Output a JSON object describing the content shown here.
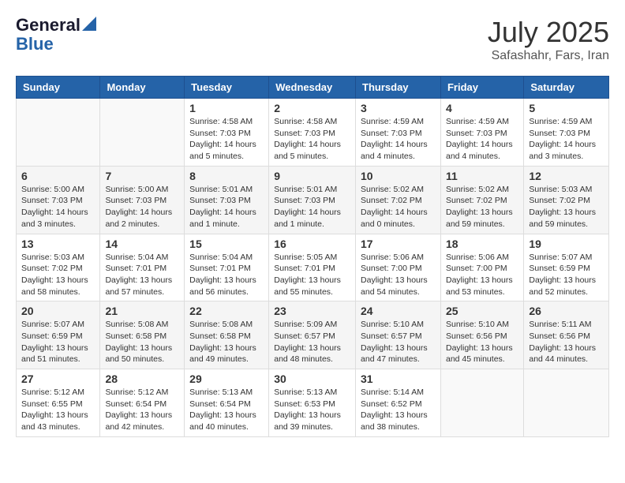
{
  "logo": {
    "general": "General",
    "blue": "Blue"
  },
  "title": {
    "month_year": "July 2025",
    "location": "Safashahr, Fars, Iran"
  },
  "weekdays": [
    "Sunday",
    "Monday",
    "Tuesday",
    "Wednesday",
    "Thursday",
    "Friday",
    "Saturday"
  ],
  "weeks": [
    [
      {
        "day": "",
        "info": ""
      },
      {
        "day": "",
        "info": ""
      },
      {
        "day": "1",
        "info": "Sunrise: 4:58 AM\nSunset: 7:03 PM\nDaylight: 14 hours\nand 5 minutes."
      },
      {
        "day": "2",
        "info": "Sunrise: 4:58 AM\nSunset: 7:03 PM\nDaylight: 14 hours\nand 5 minutes."
      },
      {
        "day": "3",
        "info": "Sunrise: 4:59 AM\nSunset: 7:03 PM\nDaylight: 14 hours\nand 4 minutes."
      },
      {
        "day": "4",
        "info": "Sunrise: 4:59 AM\nSunset: 7:03 PM\nDaylight: 14 hours\nand 4 minutes."
      },
      {
        "day": "5",
        "info": "Sunrise: 4:59 AM\nSunset: 7:03 PM\nDaylight: 14 hours\nand 3 minutes."
      }
    ],
    [
      {
        "day": "6",
        "info": "Sunrise: 5:00 AM\nSunset: 7:03 PM\nDaylight: 14 hours\nand 3 minutes."
      },
      {
        "day": "7",
        "info": "Sunrise: 5:00 AM\nSunset: 7:03 PM\nDaylight: 14 hours\nand 2 minutes."
      },
      {
        "day": "8",
        "info": "Sunrise: 5:01 AM\nSunset: 7:03 PM\nDaylight: 14 hours\nand 1 minute."
      },
      {
        "day": "9",
        "info": "Sunrise: 5:01 AM\nSunset: 7:03 PM\nDaylight: 14 hours\nand 1 minute."
      },
      {
        "day": "10",
        "info": "Sunrise: 5:02 AM\nSunset: 7:02 PM\nDaylight: 14 hours\nand 0 minutes."
      },
      {
        "day": "11",
        "info": "Sunrise: 5:02 AM\nSunset: 7:02 PM\nDaylight: 13 hours\nand 59 minutes."
      },
      {
        "day": "12",
        "info": "Sunrise: 5:03 AM\nSunset: 7:02 PM\nDaylight: 13 hours\nand 59 minutes."
      }
    ],
    [
      {
        "day": "13",
        "info": "Sunrise: 5:03 AM\nSunset: 7:02 PM\nDaylight: 13 hours\nand 58 minutes."
      },
      {
        "day": "14",
        "info": "Sunrise: 5:04 AM\nSunset: 7:01 PM\nDaylight: 13 hours\nand 57 minutes."
      },
      {
        "day": "15",
        "info": "Sunrise: 5:04 AM\nSunset: 7:01 PM\nDaylight: 13 hours\nand 56 minutes."
      },
      {
        "day": "16",
        "info": "Sunrise: 5:05 AM\nSunset: 7:01 PM\nDaylight: 13 hours\nand 55 minutes."
      },
      {
        "day": "17",
        "info": "Sunrise: 5:06 AM\nSunset: 7:00 PM\nDaylight: 13 hours\nand 54 minutes."
      },
      {
        "day": "18",
        "info": "Sunrise: 5:06 AM\nSunset: 7:00 PM\nDaylight: 13 hours\nand 53 minutes."
      },
      {
        "day": "19",
        "info": "Sunrise: 5:07 AM\nSunset: 6:59 PM\nDaylight: 13 hours\nand 52 minutes."
      }
    ],
    [
      {
        "day": "20",
        "info": "Sunrise: 5:07 AM\nSunset: 6:59 PM\nDaylight: 13 hours\nand 51 minutes."
      },
      {
        "day": "21",
        "info": "Sunrise: 5:08 AM\nSunset: 6:58 PM\nDaylight: 13 hours\nand 50 minutes."
      },
      {
        "day": "22",
        "info": "Sunrise: 5:08 AM\nSunset: 6:58 PM\nDaylight: 13 hours\nand 49 minutes."
      },
      {
        "day": "23",
        "info": "Sunrise: 5:09 AM\nSunset: 6:57 PM\nDaylight: 13 hours\nand 48 minutes."
      },
      {
        "day": "24",
        "info": "Sunrise: 5:10 AM\nSunset: 6:57 PM\nDaylight: 13 hours\nand 47 minutes."
      },
      {
        "day": "25",
        "info": "Sunrise: 5:10 AM\nSunset: 6:56 PM\nDaylight: 13 hours\nand 45 minutes."
      },
      {
        "day": "26",
        "info": "Sunrise: 5:11 AM\nSunset: 6:56 PM\nDaylight: 13 hours\nand 44 minutes."
      }
    ],
    [
      {
        "day": "27",
        "info": "Sunrise: 5:12 AM\nSunset: 6:55 PM\nDaylight: 13 hours\nand 43 minutes."
      },
      {
        "day": "28",
        "info": "Sunrise: 5:12 AM\nSunset: 6:54 PM\nDaylight: 13 hours\nand 42 minutes."
      },
      {
        "day": "29",
        "info": "Sunrise: 5:13 AM\nSunset: 6:54 PM\nDaylight: 13 hours\nand 40 minutes."
      },
      {
        "day": "30",
        "info": "Sunrise: 5:13 AM\nSunset: 6:53 PM\nDaylight: 13 hours\nand 39 minutes."
      },
      {
        "day": "31",
        "info": "Sunrise: 5:14 AM\nSunset: 6:52 PM\nDaylight: 13 hours\nand 38 minutes."
      },
      {
        "day": "",
        "info": ""
      },
      {
        "day": "",
        "info": ""
      }
    ]
  ]
}
